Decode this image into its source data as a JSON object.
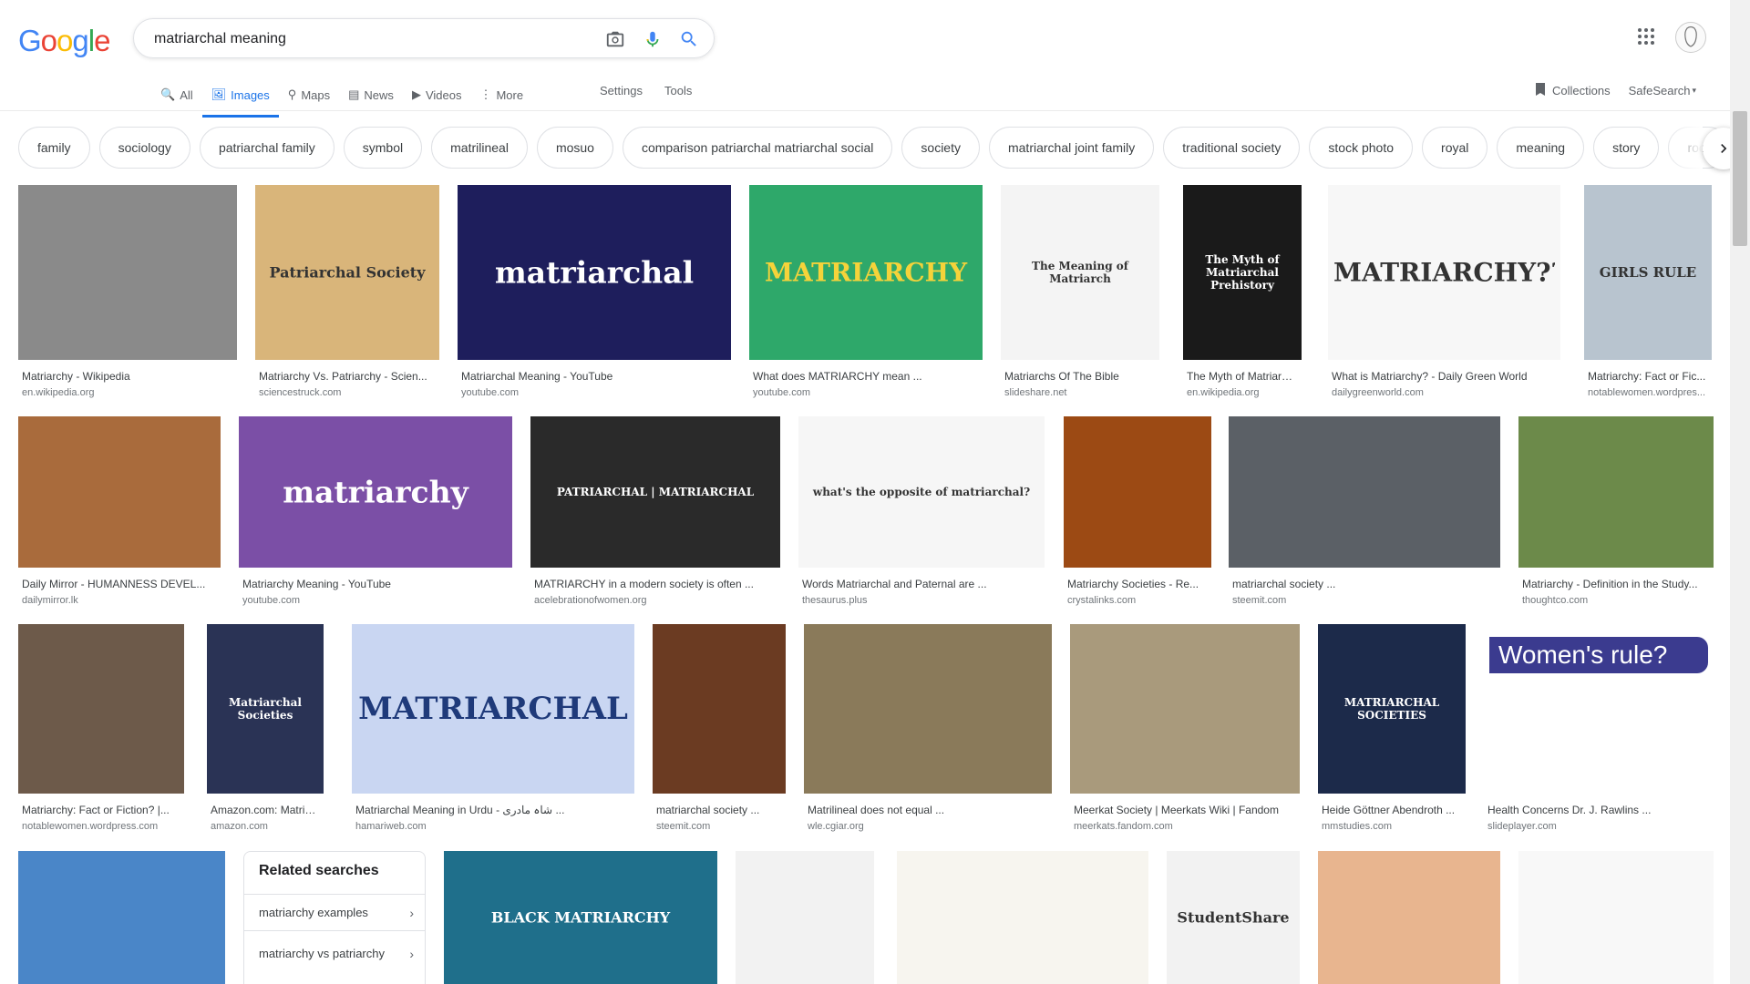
{
  "logo": {
    "letters": [
      "G",
      "o",
      "o",
      "g",
      "l",
      "e"
    ],
    "colors": [
      "#4285f4",
      "#ea4335",
      "#fbbc05",
      "#4285f4",
      "#34a853",
      "#ea4335"
    ]
  },
  "search": {
    "value": "matriarchal meaning",
    "placeholder": ""
  },
  "icons": {
    "camera": "camera-icon",
    "mic": "mic-icon",
    "search": "search-icon",
    "apps": "apps-icon"
  },
  "tabs": [
    {
      "label": "All",
      "icon": "🔍",
      "active": false
    },
    {
      "label": "Images",
      "icon": "🖼",
      "active": true
    },
    {
      "label": "Maps",
      "icon": "⚲",
      "active": false
    },
    {
      "label": "News",
      "icon": "▤",
      "active": false
    },
    {
      "label": "Videos",
      "icon": "▶",
      "active": false
    },
    {
      "label": "More",
      "icon": "⋮",
      "active": false
    }
  ],
  "tools": {
    "settings": "Settings",
    "tools": "Tools"
  },
  "header_right": {
    "collections": "Collections",
    "safesearch": "SafeSearch"
  },
  "chips": [
    "family",
    "sociology",
    "patriarchal family",
    "symbol",
    "matrilineal",
    "mosuo",
    "comparison patriarchal matriarchal social",
    "society",
    "matriarchal joint family",
    "traditional society",
    "stock photo",
    "royal",
    "meaning",
    "story",
    "root"
  ],
  "results": [
    {
      "caption": "Matriarchy - Wikipedia",
      "source": "en.wikipedia.org",
      "bg": "#8a8a8a",
      "overlay": ""
    },
    {
      "caption": "Matriarchy Vs. Patriarchy - Scien...",
      "source": "sciencestruck.com",
      "bg": "#d9b57a",
      "overlay": "Patriarchal Society"
    },
    {
      "caption": "Matriarchal Meaning - YouTube",
      "source": "youtube.com",
      "bg": "#1e1e5c",
      "overlay": "matriarchal"
    },
    {
      "caption": "What does MATRIARCHY mean ...",
      "source": "youtube.com",
      "bg": "#2ea86a",
      "overlay": "MATRIARCHY"
    },
    {
      "caption": "Matriarchs Of The Bible",
      "source": "slideshare.net",
      "bg": "#f4f4f4",
      "overlay": "The Meaning of Matriarch"
    },
    {
      "caption": "The Myth of Matriarch...",
      "source": "en.wikipedia.org",
      "bg": "#1a1a1a",
      "overlay": "The Myth of Matriarchal Prehistory"
    },
    {
      "caption": "What is Matriarchy? - Daily Green World",
      "source": "dailygreenworld.com",
      "bg": "#f7f7f7",
      "overlay": "MATRIARCHY???"
    },
    {
      "caption": "Matriarchy: Fact or Fic...",
      "source": "notablewomen.wordpres...",
      "bg": "#b8c4cf",
      "overlay": "GIRLS RULE"
    },
    {
      "caption": "Daily Mirror - HUMANNESS DEVEL...",
      "source": "dailymirror.lk",
      "bg": "#a96b3c",
      "overlay": ""
    },
    {
      "caption": "Matriarchy Meaning - YouTube",
      "source": "youtube.com",
      "bg": "#7b4fa6",
      "overlay": "matriarchy"
    },
    {
      "caption": "MATRIARCHY in a modern society is often ...",
      "source": "acelebrationofwomen.org",
      "bg": "#2a2a2a",
      "overlay": "PATRIARCHAL | MATRIARCHAL"
    },
    {
      "caption": "Words Matriarchal and Paternal are ...",
      "source": "thesaurus.plus",
      "bg": "#f6f6f6",
      "overlay": "what's the opposite of matriarchal?"
    },
    {
      "caption": "Matriarchy Societies - Re...",
      "source": "crystalinks.com",
      "bg": "#9c4a14",
      "overlay": ""
    },
    {
      "caption": "matriarchal society ...",
      "source": "steemit.com",
      "bg": "#5b6066",
      "overlay": ""
    },
    {
      "caption": "Matriarchy - Definition in the Study...",
      "source": "thoughtco.com",
      "bg": "#6c8a4a",
      "overlay": ""
    },
    {
      "caption": "Matriarchy: Fact or Fiction? |...",
      "source": "notablewomen.wordpress.com",
      "bg": "#6d5a4a",
      "overlay": ""
    },
    {
      "caption": "Amazon.com: Matriarc...",
      "source": "amazon.com",
      "bg": "#2a3355",
      "overlay": "Matriarchal Societies"
    },
    {
      "caption": "Matriarchal Meaning in Urdu - شاہ مادری ...",
      "source": "hamariweb.com",
      "bg": "#c9d6f2",
      "overlay": "MATRIARCHAL"
    },
    {
      "caption": "matriarchal society ...",
      "source": "steemit.com",
      "bg": "#6b3b22",
      "overlay": ""
    },
    {
      "caption": "Matrilineal does not equal ...",
      "source": "wle.cgiar.org",
      "bg": "#8a7a5a",
      "overlay": ""
    },
    {
      "caption": "Meerkat Society | Meerkats Wiki | Fandom",
      "source": "meerkats.fandom.com",
      "bg": "#a99a7c",
      "overlay": ""
    },
    {
      "caption": "Heide Göttner Abendroth ...",
      "source": "mmstudies.com",
      "bg": "#1c2a4a",
      "overlay": "MATRIARCHAL SOCIETIES"
    },
    {
      "caption": "Health Concerns Dr. J. Rawlins ...",
      "source": "slideplayer.com",
      "bg": "#ffffff",
      "overlay": "Women's rule?"
    },
    {
      "caption": "",
      "source": "",
      "bg": "#4a86c8",
      "overlay": ""
    },
    {
      "caption": "",
      "source": "",
      "bg": "#1f6f8b",
      "overlay": "BLACK MATRIARCHY"
    },
    {
      "caption": "",
      "source": "",
      "bg": "#f2f2f2",
      "overlay": ""
    },
    {
      "caption": "",
      "source": "",
      "bg": "#f7f5ef",
      "overlay": ""
    },
    {
      "caption": "",
      "source": "",
      "bg": "#f2f2f2",
      "overlay": "StudentShare"
    },
    {
      "caption": "",
      "source": "",
      "bg": "#e8b58f",
      "overlay": ""
    },
    {
      "caption": "",
      "source": "",
      "bg": "#f8f8f8",
      "overlay": ""
    }
  ],
  "related": {
    "title": "Related searches",
    "items": [
      "matriarchy examples",
      "matriarchy vs patriarchy"
    ]
  }
}
